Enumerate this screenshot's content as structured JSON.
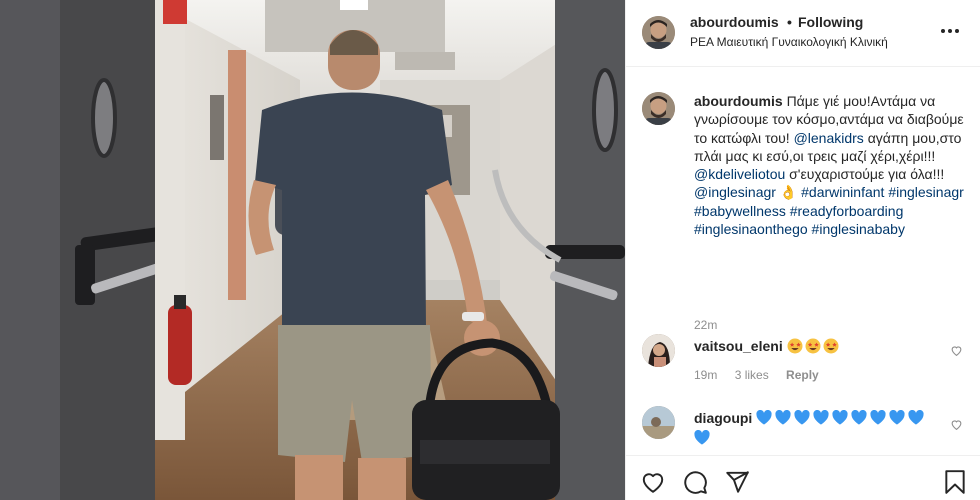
{
  "post": {
    "author": "abourdoumis",
    "separator": "•",
    "follow_status": "Following",
    "location": "ΡΕΑ Μαιευτική Γυναικολογική Κλινική"
  },
  "caption": {
    "username": "abourdoumis",
    "segments": [
      {
        "text": "Πάμε γιέ μου!Αντάμα να γνωρίσουμε τον κόσμο,αντάμα να διαβούμε το κατώφλι του! ",
        "link": false
      },
      {
        "text": "@lenakidrs",
        "link": true
      },
      {
        "text": " αγάπη μου,στο πλάι μας κι εσύ,οι τρεις μαζί χέρι,χέρι!!! ",
        "link": false
      },
      {
        "text": "@kdeliveliotou",
        "link": true
      },
      {
        "text": " σ'ευχαριστούμε για όλα!!! ",
        "link": false
      },
      {
        "text": "@inglesinagr",
        "link": true
      },
      {
        "text": " 👌 ",
        "link": false
      },
      {
        "text": "#darwininfant",
        "link": true
      },
      {
        "text": " ",
        "link": false
      },
      {
        "text": "#inglesinagr",
        "link": true
      },
      {
        "text": " ",
        "link": false
      },
      {
        "text": "#babywellness",
        "link": true
      },
      {
        "text": " ",
        "link": false
      },
      {
        "text": "#readyforboarding",
        "link": true
      },
      {
        "text": " ",
        "link": false
      },
      {
        "text": "#inglesinaonthego",
        "link": true
      },
      {
        "text": " ",
        "link": false
      },
      {
        "text": "#inglesinababy",
        "link": true
      }
    ],
    "time": "22m"
  },
  "comments": [
    {
      "username": "vaitsou_eleni",
      "emoji": "🤩",
      "emoji_count": 3,
      "time": "19m",
      "likes": "3 likes",
      "reply": "Reply"
    },
    {
      "username": "diagoupi",
      "emoji": "💙",
      "emoji_count": 10
    }
  ],
  "icons": {
    "more": "more-options-icon",
    "like": "heart-icon",
    "comment": "comment-icon",
    "share": "share-icon",
    "save": "bookmark-icon"
  },
  "colors": {
    "link": "#00376b",
    "muted": "#8e8e8e",
    "text": "#262626",
    "border": "#efefef",
    "heart_emoji": "#3897f0"
  }
}
